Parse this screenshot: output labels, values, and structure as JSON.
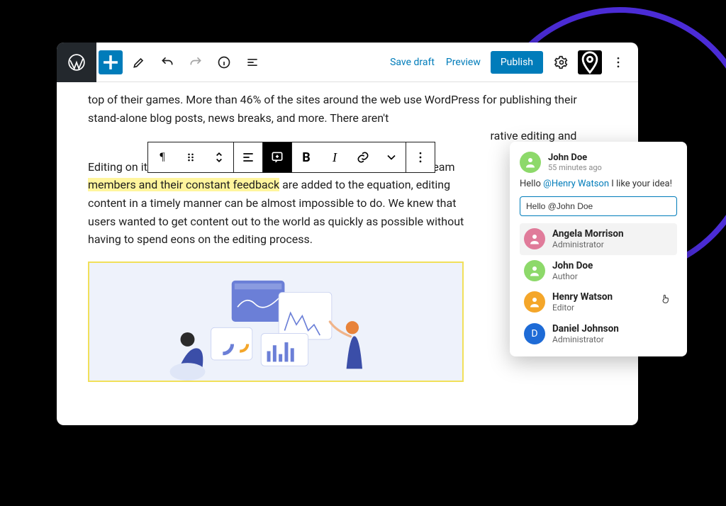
{
  "header": {
    "save_draft": "Save draft",
    "preview": "Preview",
    "publish": "Publish"
  },
  "content": {
    "p1_a": "top of their games. More than 46% of the sites around the web use WordPress for publishing their stand-alone blog posts, news breaks, and more. There aren't",
    "p1_b": "rative editing and",
    "p2_a": "Editing on its own takes time, effort, and brainpower. When multiple team ",
    "p2_hl": "members and their constant feedback",
    "p2_b": " are added to the equation, editing content in a timely manner can be almost impossible to do. We knew that users wanted to get content out to the world as quickly as possible without having to spend eons on the editing process."
  },
  "block_toolbar": {
    "bold": "B",
    "italic": "I"
  },
  "comment": {
    "author": "John Doe",
    "time": "55 minutes ago",
    "body_pre": "Hello ",
    "mention": "@Henry Watson",
    "body_post": " I like your idea!",
    "reply_value": "Hello @John Doe"
  },
  "users": [
    {
      "name": "Angela Morrison",
      "role": "Administrator",
      "avatar": "pink",
      "hover": true
    },
    {
      "name": "John Doe",
      "role": "Author",
      "avatar": "lightgreen",
      "hover": false
    },
    {
      "name": "Henry Watson",
      "role": "Editor",
      "avatar": "orange",
      "hover": false,
      "cursor": true
    },
    {
      "name": "Daniel Johnson",
      "role": "Administrator",
      "avatar": "blue",
      "hover": false,
      "initial": "D"
    }
  ]
}
